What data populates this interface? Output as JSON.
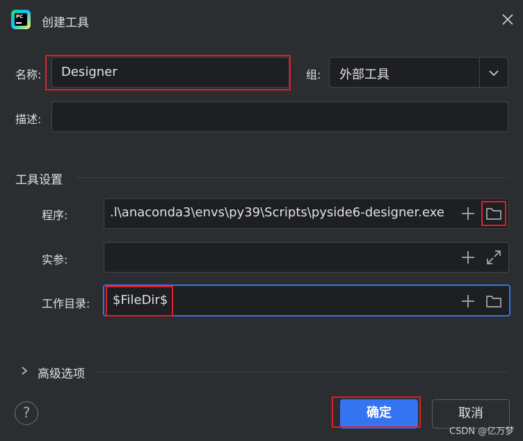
{
  "window": {
    "title": "创建工具",
    "close_icon": "close-icon"
  },
  "form": {
    "name_label": "名称:",
    "name_value": "Designer",
    "group_label": "组:",
    "group_value": "外部工具",
    "description_label": "描述:",
    "description_value": ""
  },
  "tool_settings": {
    "section_title": "工具设置",
    "program_label": "程序:",
    "program_value": ".l\\anaconda3\\envs\\py39\\Scripts\\pyside6-designer.exe",
    "arguments_label": "实参:",
    "arguments_value": "",
    "workdir_label": "工作目录:",
    "workdir_value": "$FileDir$"
  },
  "advanced": {
    "label": "高级选项"
  },
  "footer": {
    "help": "?",
    "ok_label": "确定",
    "cancel_label": "取消",
    "watermark": "CSDN @亿万梦"
  },
  "colors": {
    "background": "#2b2d30",
    "field_background": "#1e1f22",
    "accent": "#3574f0",
    "highlight": "#e0202a"
  }
}
